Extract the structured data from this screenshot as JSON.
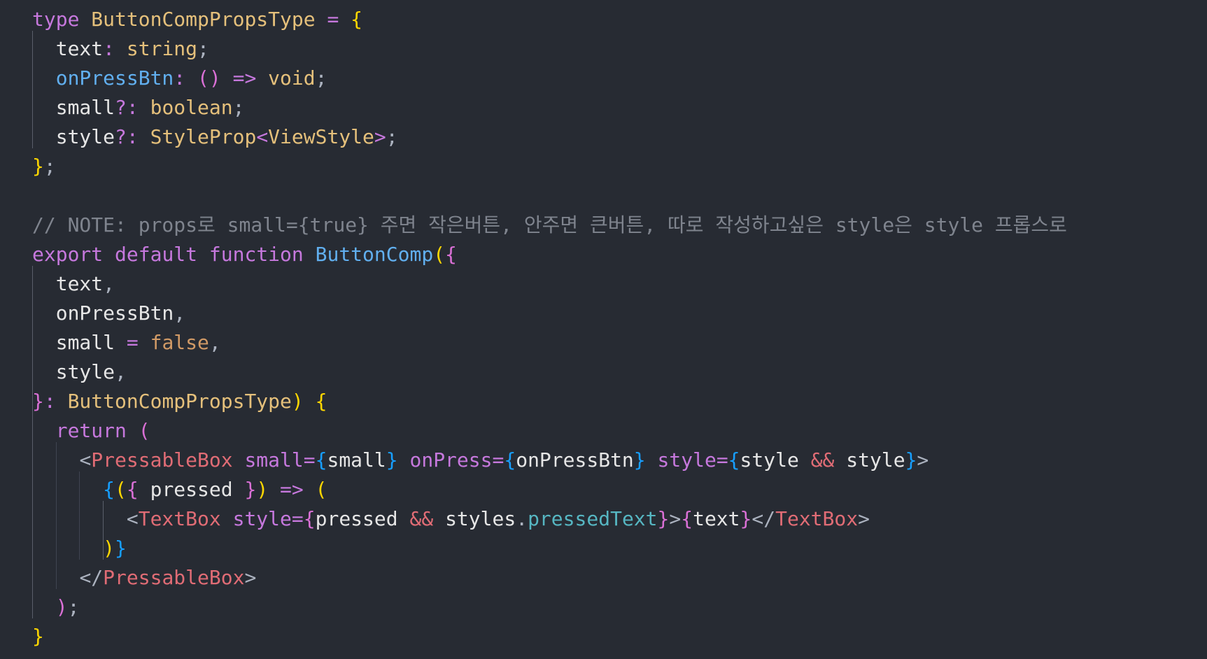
{
  "editor": {
    "language": "tsx",
    "theme_colors": {
      "background": "#272B33",
      "keyword": "#C678DD",
      "type": "#E5C07B",
      "function": "#61AFEF",
      "property": "#E6E6E6",
      "punctuation": "#ABB2BF",
      "comment": "#7F848E",
      "boolean": "#D19A66",
      "tag": "#E06C75",
      "attribute": "#C678DD",
      "brace_gold": "#FFD700",
      "brace_purple": "#DA70D6",
      "brace_blue": "#179FFF",
      "operator": "#56B6C2"
    },
    "lines": [
      [
        [
          "type",
          "#C678DD"
        ],
        [
          " ",
          "#E6E6E6"
        ],
        [
          "ButtonCompPropsType",
          "#E5C07B"
        ],
        [
          " ",
          "#E6E6E6"
        ],
        [
          "=",
          "#C678DD"
        ],
        [
          " ",
          "#E6E6E6"
        ],
        [
          "{",
          "#FFD700"
        ]
      ],
      [
        [
          "  ",
          "#E6E6E6"
        ],
        [
          "text",
          "#E6E6E6"
        ],
        [
          ":",
          "#C678DD"
        ],
        [
          " ",
          "#E6E6E6"
        ],
        [
          "string",
          "#E5C07B"
        ],
        [
          ";",
          "#ABB2BF"
        ]
      ],
      [
        [
          "  ",
          "#E6E6E6"
        ],
        [
          "onPressBtn",
          "#61AFEF"
        ],
        [
          ":",
          "#C678DD"
        ],
        [
          " ",
          "#E6E6E6"
        ],
        [
          "()",
          "#DA70D6"
        ],
        [
          " ",
          "#E6E6E6"
        ],
        [
          "=>",
          "#C678DD"
        ],
        [
          " ",
          "#E6E6E6"
        ],
        [
          "void",
          "#E5C07B"
        ],
        [
          ";",
          "#ABB2BF"
        ]
      ],
      [
        [
          "  ",
          "#E6E6E6"
        ],
        [
          "small",
          "#E6E6E6"
        ],
        [
          "?:",
          "#C678DD"
        ],
        [
          " ",
          "#E6E6E6"
        ],
        [
          "boolean",
          "#E5C07B"
        ],
        [
          ";",
          "#ABB2BF"
        ]
      ],
      [
        [
          "  ",
          "#E6E6E6"
        ],
        [
          "style",
          "#E6E6E6"
        ],
        [
          "?:",
          "#C678DD"
        ],
        [
          " ",
          "#E6E6E6"
        ],
        [
          "StyleProp",
          "#E5C07B"
        ],
        [
          "<",
          "#C678DD"
        ],
        [
          "ViewStyle",
          "#E5C07B"
        ],
        [
          ">",
          "#C678DD"
        ],
        [
          ";",
          "#ABB2BF"
        ]
      ],
      [
        [
          "}",
          "#FFD700"
        ],
        [
          ";",
          "#ABB2BF"
        ]
      ],
      [],
      [
        [
          "// NOTE: props로 small={true} 주면 작은버튼, 안주면 큰버튼, 따로 작성하고싶은 style은 style 프롭스로",
          "#7F848E"
        ]
      ],
      [
        [
          "export",
          "#C678DD"
        ],
        [
          " ",
          "#E6E6E6"
        ],
        [
          "default",
          "#C678DD"
        ],
        [
          " ",
          "#E6E6E6"
        ],
        [
          "function",
          "#C678DD"
        ],
        [
          " ",
          "#E6E6E6"
        ],
        [
          "ButtonComp",
          "#61AFEF"
        ],
        [
          "(",
          "#FFD700"
        ],
        [
          "{",
          "#DA70D6"
        ]
      ],
      [
        [
          "  ",
          "#E6E6E6"
        ],
        [
          "text",
          "#E6E6E6"
        ],
        [
          ",",
          "#ABB2BF"
        ]
      ],
      [
        [
          "  ",
          "#E6E6E6"
        ],
        [
          "onPressBtn",
          "#E6E6E6"
        ],
        [
          ",",
          "#ABB2BF"
        ]
      ],
      [
        [
          "  ",
          "#E6E6E6"
        ],
        [
          "small",
          "#E6E6E6"
        ],
        [
          " ",
          "#E6E6E6"
        ],
        [
          "=",
          "#C678DD"
        ],
        [
          " ",
          "#E6E6E6"
        ],
        [
          "false",
          "#D19A66"
        ],
        [
          ",",
          "#ABB2BF"
        ]
      ],
      [
        [
          "  ",
          "#E6E6E6"
        ],
        [
          "style",
          "#E6E6E6"
        ],
        [
          ",",
          "#ABB2BF"
        ]
      ],
      [
        [
          "}",
          "#DA70D6"
        ],
        [
          ":",
          "#C678DD"
        ],
        [
          " ",
          "#E6E6E6"
        ],
        [
          "ButtonCompPropsType",
          "#E5C07B"
        ],
        [
          ")",
          "#FFD700"
        ],
        [
          " ",
          "#E6E6E6"
        ],
        [
          "{",
          "#FFD700"
        ]
      ],
      [
        [
          "  ",
          "#E6E6E6"
        ],
        [
          "return",
          "#C678DD"
        ],
        [
          " ",
          "#E6E6E6"
        ],
        [
          "(",
          "#DA70D6"
        ]
      ],
      [
        [
          "    ",
          "#E6E6E6"
        ],
        [
          "<",
          "#ABB2BF"
        ],
        [
          "PressableBox",
          "#E06C75"
        ],
        [
          " ",
          "#E6E6E6"
        ],
        [
          "small",
          "#C678DD"
        ],
        [
          "=",
          "#C678DD"
        ],
        [
          "{",
          "#179FFF"
        ],
        [
          "small",
          "#E6E6E6"
        ],
        [
          "}",
          "#179FFF"
        ],
        [
          " ",
          "#E6E6E6"
        ],
        [
          "onPress",
          "#C678DD"
        ],
        [
          "=",
          "#C678DD"
        ],
        [
          "{",
          "#179FFF"
        ],
        [
          "onPressBtn",
          "#E6E6E6"
        ],
        [
          "}",
          "#179FFF"
        ],
        [
          " ",
          "#E6E6E6"
        ],
        [
          "style",
          "#C678DD"
        ],
        [
          "=",
          "#C678DD"
        ],
        [
          "{",
          "#179FFF"
        ],
        [
          "style",
          "#E6E6E6"
        ],
        [
          " ",
          "#E6E6E6"
        ],
        [
          "&&",
          "#E06C75"
        ],
        [
          " ",
          "#E6E6E6"
        ],
        [
          "style",
          "#E6E6E6"
        ],
        [
          "}",
          "#179FFF"
        ],
        [
          ">",
          "#ABB2BF"
        ]
      ],
      [
        [
          "      ",
          "#E6E6E6"
        ],
        [
          "{",
          "#179FFF"
        ],
        [
          "(",
          "#FFD700"
        ],
        [
          "{",
          "#DA70D6"
        ],
        [
          " ",
          "#E6E6E6"
        ],
        [
          "pressed",
          "#E6E6E6"
        ],
        [
          " ",
          "#E6E6E6"
        ],
        [
          "}",
          "#DA70D6"
        ],
        [
          ")",
          "#FFD700"
        ],
        [
          " ",
          "#E6E6E6"
        ],
        [
          "=>",
          "#C678DD"
        ],
        [
          " ",
          "#E6E6E6"
        ],
        [
          "(",
          "#FFD700"
        ]
      ],
      [
        [
          "        ",
          "#E6E6E6"
        ],
        [
          "<",
          "#ABB2BF"
        ],
        [
          "TextBox",
          "#E06C75"
        ],
        [
          " ",
          "#E6E6E6"
        ],
        [
          "style",
          "#C678DD"
        ],
        [
          "=",
          "#C678DD"
        ],
        [
          "{",
          "#DA70D6"
        ],
        [
          "pressed",
          "#E6E6E6"
        ],
        [
          " ",
          "#E6E6E6"
        ],
        [
          "&&",
          "#E06C75"
        ],
        [
          " ",
          "#E6E6E6"
        ],
        [
          "styles",
          "#E6E6E6"
        ],
        [
          ".",
          "#ABB2BF"
        ],
        [
          "pressedText",
          "#56B6C2"
        ],
        [
          "}",
          "#DA70D6"
        ],
        [
          ">",
          "#ABB2BF"
        ],
        [
          "{",
          "#DA70D6"
        ],
        [
          "text",
          "#E6E6E6"
        ],
        [
          "}",
          "#DA70D6"
        ],
        [
          "</",
          "#ABB2BF"
        ],
        [
          "TextBox",
          "#E06C75"
        ],
        [
          ">",
          "#ABB2BF"
        ]
      ],
      [
        [
          "      ",
          "#E6E6E6"
        ],
        [
          ")",
          "#FFD700"
        ],
        [
          "}",
          "#179FFF"
        ]
      ],
      [
        [
          "    ",
          "#E6E6E6"
        ],
        [
          "</",
          "#ABB2BF"
        ],
        [
          "PressableBox",
          "#E06C75"
        ],
        [
          ">",
          "#ABB2BF"
        ]
      ],
      [
        [
          "  ",
          "#E6E6E6"
        ],
        [
          ")",
          "#DA70D6"
        ],
        [
          ";",
          "#ABB2BF"
        ]
      ],
      [
        [
          "}",
          "#FFD700"
        ]
      ]
    ]
  }
}
